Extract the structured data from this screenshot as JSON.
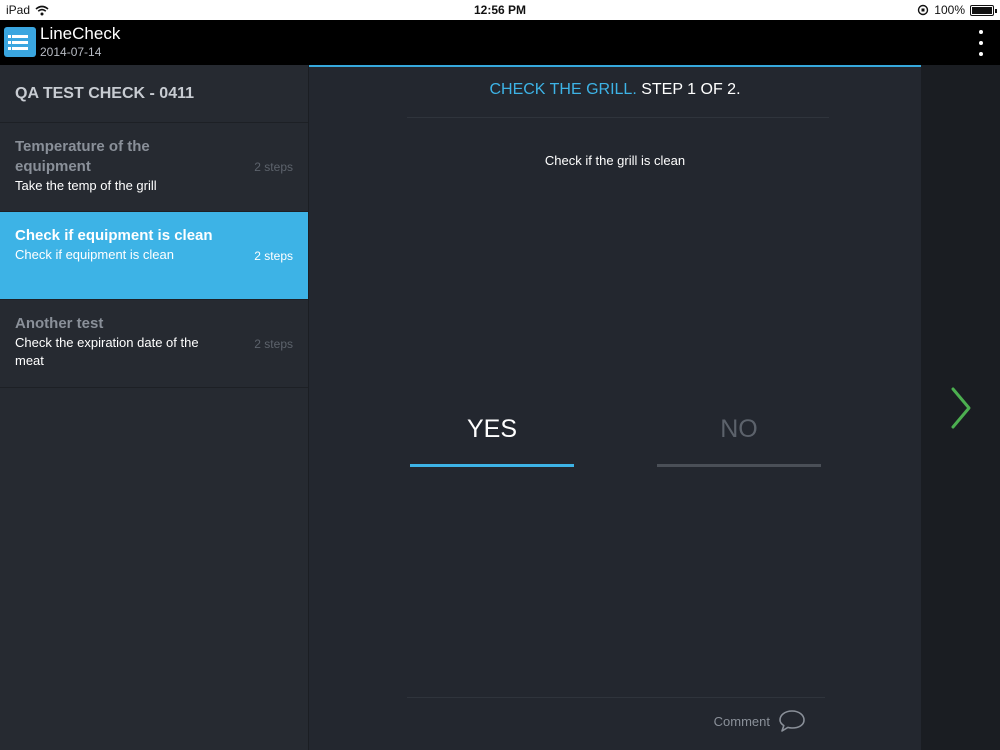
{
  "statusbar": {
    "device": "iPad",
    "time": "12:56 PM",
    "battery": "100%",
    "battery_level": 1.0
  },
  "app": {
    "title": "LineCheck",
    "date": "2014-07-14",
    "logo_icon": "checklist-icon",
    "menu_icon": "more-vertical-icon"
  },
  "sidebar": {
    "header": "QA TEST CHECK - 0411",
    "items": [
      {
        "title": "Temperature of the equipment",
        "description": "Take the temp of the grill",
        "steps": "2 steps",
        "active": false
      },
      {
        "title": "Check if equipment is clean",
        "description": "Check if equipment is clean",
        "steps": "2 steps",
        "active": true
      },
      {
        "title": "Another test",
        "description": "Check the expiration date of the meat",
        "steps": "2 steps",
        "active": false
      }
    ]
  },
  "main": {
    "title_accent": "CHECK THE GRILL.",
    "title_rest": "STEP 1 OF 2.",
    "question": "Check if the grill is clean",
    "yes_label": "YES",
    "no_label": "NO",
    "comment_label": "Comment",
    "comment_icon": "speech-bubble-icon"
  },
  "navigation": {
    "next_icon": "chevron-right-icon"
  },
  "colors": {
    "accent": "#3db3e6",
    "next_arrow": "#4caf50",
    "background": "#23272f"
  }
}
